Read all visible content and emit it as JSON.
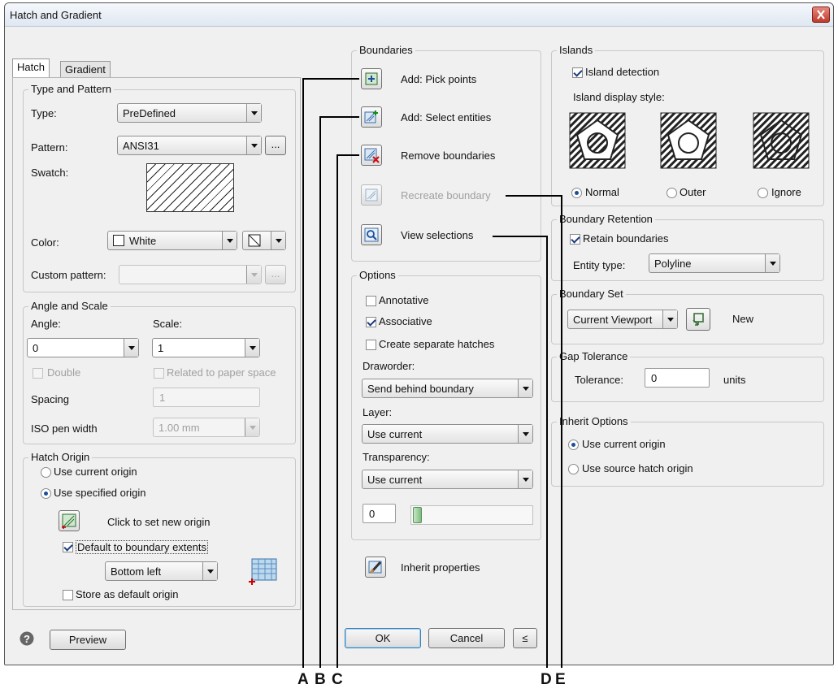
{
  "window": {
    "title": "Hatch and Gradient"
  },
  "tabs": [
    "Hatch",
    "Gradient"
  ],
  "type_pattern": {
    "legend": "Type and Pattern",
    "type_label": "Type:",
    "type_value": "PreDefined",
    "pattern_label": "Pattern:",
    "pattern_value": "ANSI31",
    "browse_label": "...",
    "swatch_label": "Swatch:",
    "color_label": "Color:",
    "color_value": "White",
    "custom_label": "Custom pattern:"
  },
  "angle_scale": {
    "legend": "Angle and Scale",
    "angle_label": "Angle:",
    "angle_value": "0",
    "scale_label": "Scale:",
    "scale_value": "1",
    "double_label": "Double",
    "related_label": "Related to paper space",
    "spacing_label": "Spacing",
    "spacing_value": "1",
    "iso_label": "ISO pen width",
    "iso_value": "1.00 mm"
  },
  "hatch_origin": {
    "legend": "Hatch Origin",
    "use_current": "Use current origin",
    "use_specified": "Use specified origin",
    "click_set": "Click to set new origin",
    "default_extents": "Default to boundary extents",
    "position_value": "Bottom left",
    "store_default": "Store as default origin"
  },
  "boundaries": {
    "legend": "Boundaries",
    "add_pick": "Add: Pick points",
    "add_select": "Add: Select entities",
    "remove": "Remove boundaries",
    "recreate": "Recreate boundary",
    "view": "View selections"
  },
  "options": {
    "legend": "Options",
    "annotative": "Annotative",
    "associative": "Associative",
    "separate": "Create separate hatches",
    "draworder_label": "Draworder:",
    "draworder_value": "Send behind boundary",
    "layer_label": "Layer:",
    "layer_value": "Use current",
    "transparency_label": "Transparency:",
    "transparency_value": "Use current",
    "transparency_amount": "0"
  },
  "inherit_properties": "Inherit properties",
  "islands": {
    "legend": "Islands",
    "detection": "Island detection",
    "style_label": "Island display style:",
    "normal": "Normal",
    "outer": "Outer",
    "ignore": "Ignore"
  },
  "retention": {
    "legend": "Boundary Retention",
    "retain": "Retain boundaries",
    "entity_label": "Entity type:",
    "entity_value": "Polyline"
  },
  "boundary_set": {
    "legend": "Boundary Set",
    "value": "Current Viewport",
    "new_label": "New"
  },
  "gap": {
    "legend": "Gap Tolerance",
    "tolerance_label": "Tolerance:",
    "tolerance_value": "0",
    "units": "units"
  },
  "inherit_options": {
    "legend": "Inherit Options",
    "use_current": "Use current origin",
    "use_source": "Use source hatch origin"
  },
  "footer": {
    "preview": "Preview",
    "ok": "OK",
    "cancel": "Cancel",
    "less": "≤"
  },
  "callouts": [
    "A",
    "B",
    "C",
    "D",
    "E"
  ],
  "colors": {
    "accent": "#1c4e9c",
    "close": "#c03a2b",
    "title_bg": "#dfe7f1"
  }
}
